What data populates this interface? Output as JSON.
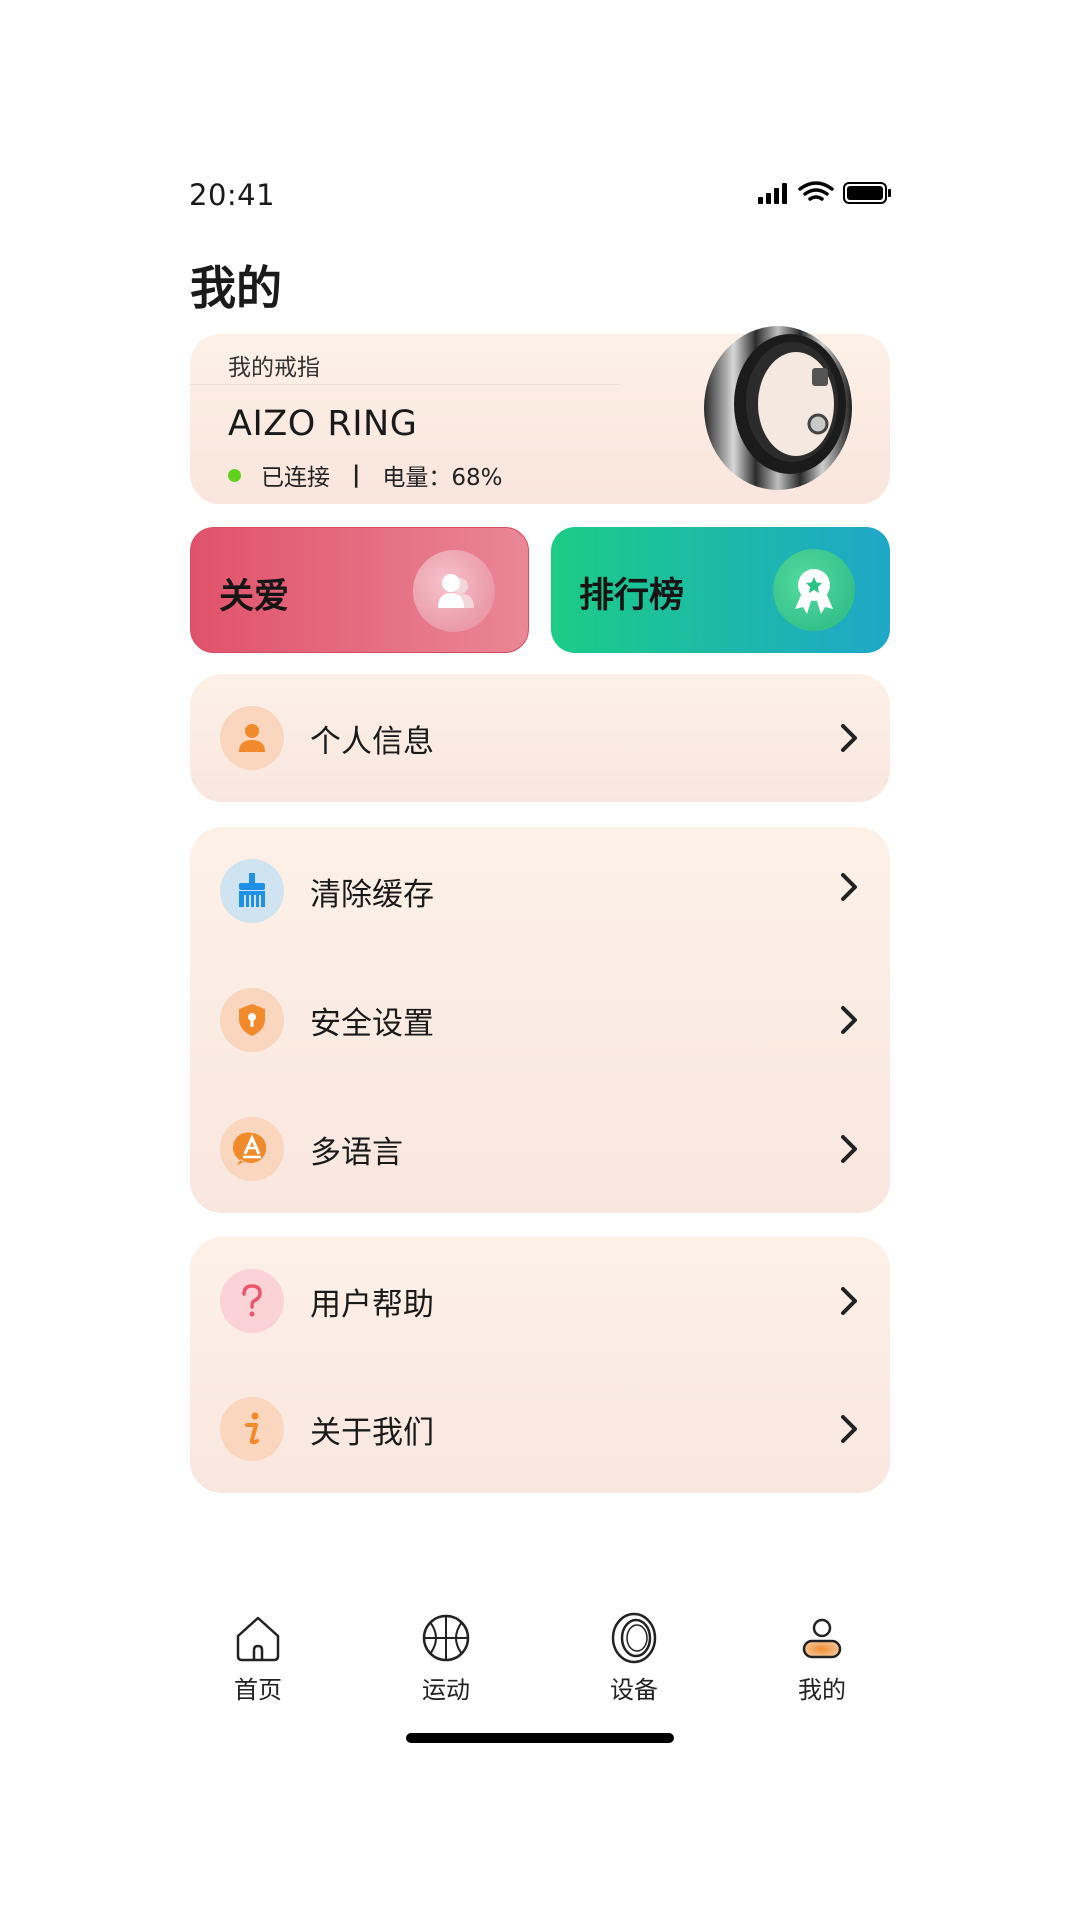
{
  "status_bar": {
    "time": "20:41"
  },
  "page": {
    "title": "我的"
  },
  "device": {
    "label": "我的戒指",
    "name": "AIZO RING",
    "connection": "已连接",
    "separator": "|",
    "battery": "电量：68%",
    "status_color": "#5fd31c"
  },
  "tiles": [
    {
      "label": "关爱",
      "icon": "care-people-icon"
    },
    {
      "label": "排行榜",
      "icon": "rank-badge-icon"
    }
  ],
  "menu": {
    "group1": [
      {
        "label": "个人信息",
        "icon": "person-icon"
      }
    ],
    "group2": [
      {
        "label": "清除缓存",
        "icon": "broom-icon"
      },
      {
        "label": "安全设置",
        "icon": "shield-icon"
      },
      {
        "label": "多语言",
        "icon": "language-icon"
      }
    ],
    "group3": [
      {
        "label": "用户帮助",
        "icon": "question-icon"
      },
      {
        "label": "关于我们",
        "icon": "info-icon"
      }
    ]
  },
  "nav": [
    {
      "label": "首页",
      "icon": "home-icon"
    },
    {
      "label": "运动",
      "icon": "basketball-icon"
    },
    {
      "label": "设备",
      "icon": "ring-icon"
    },
    {
      "label": "我的",
      "icon": "profile-icon",
      "active": true
    }
  ],
  "colors": {
    "accent": "#f08a2b",
    "care": "#e0526a",
    "rank": "#1ccc86"
  }
}
